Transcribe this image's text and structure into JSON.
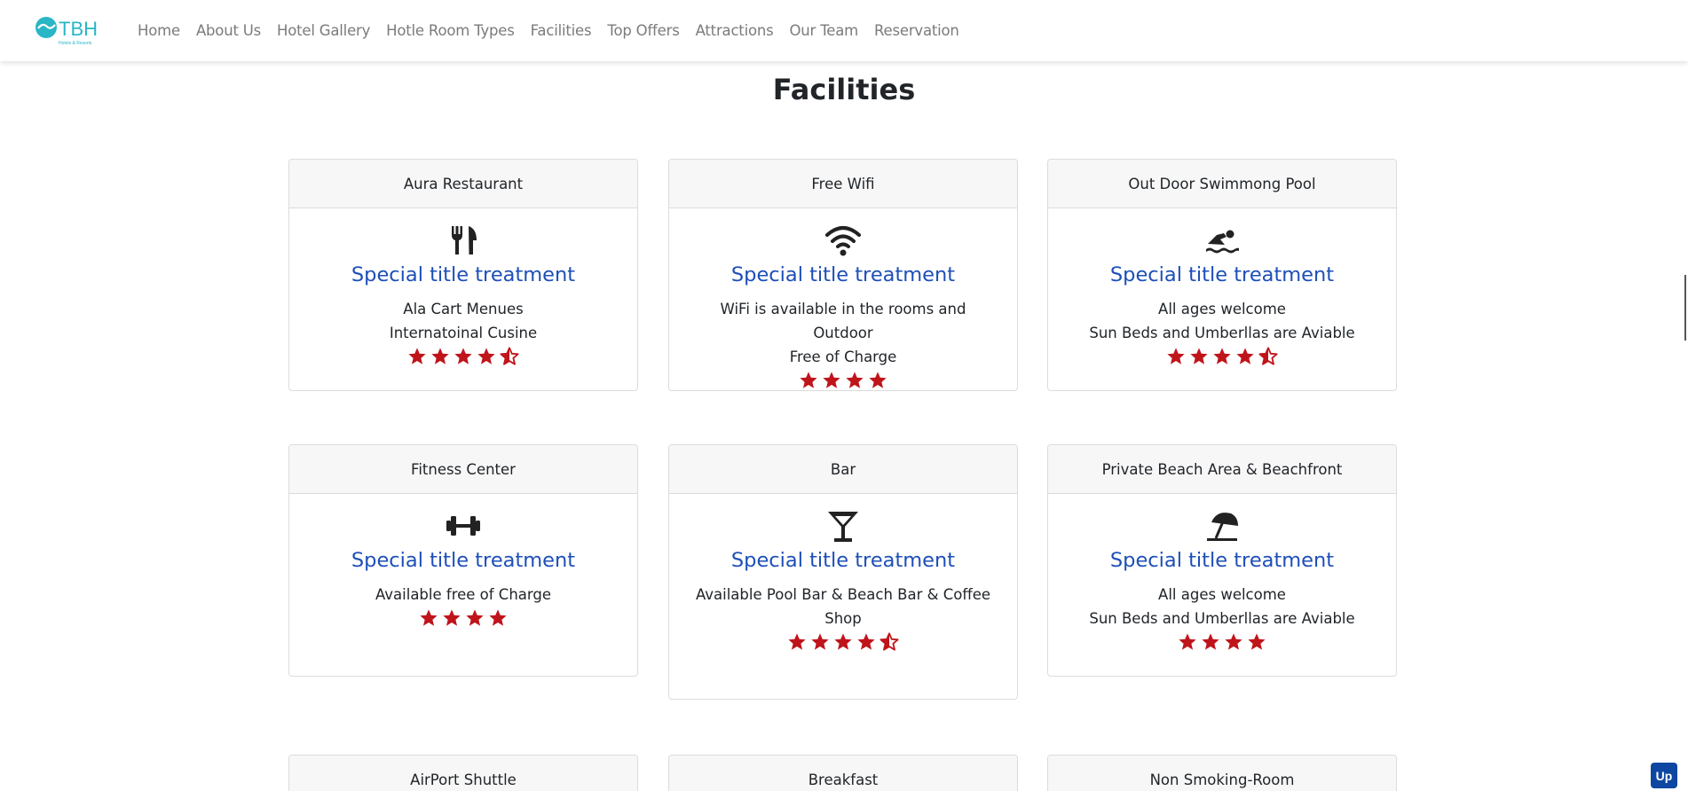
{
  "brand": {
    "logo_text": "TBH",
    "logo_subtext": "Hotels & Resorts",
    "accent_color": "#29b6c6"
  },
  "nav": {
    "items": [
      "Home",
      "About Us",
      "Hotel Gallery",
      "Hotle Room Types",
      "Facilities",
      "Top Offers",
      "Attractions",
      "Our Team",
      "Reservation"
    ]
  },
  "section": {
    "title": "Facilities"
  },
  "colors": {
    "title_blue": "#1d4fb8",
    "star_red": "#c0141b"
  },
  "cards": [
    {
      "header": "Aura Restaurant",
      "icon": "utensils-icon",
      "title": "Special title treatment",
      "lines": [
        "Ala Cart Menues",
        "Internatoinal Cusine"
      ],
      "rating": 4.5
    },
    {
      "header": "Free Wifi",
      "icon": "wifi-icon",
      "title": "Special title treatment",
      "lines": [
        "WiFi is available in the rooms and Outdoor",
        "Free of Charge"
      ],
      "rating": 4
    },
    {
      "header": "Out Door Swimmong Pool",
      "icon": "swimmer-icon",
      "title": "Special title treatment",
      "lines": [
        "All ages welcome",
        "Sun Beds and Umberllas are Aviable"
      ],
      "rating": 4.5
    },
    {
      "header": "Fitness Center",
      "icon": "dumbbell-icon",
      "title": "Special title treatment",
      "lines": [
        "Available free of Charge"
      ],
      "rating": 4
    },
    {
      "header": "Bar",
      "icon": "cocktail-icon",
      "title": "Special title treatment",
      "lines": [
        "Available Pool Bar & Beach Bar & Coffee",
        "Shop"
      ],
      "rating": 4.5
    },
    {
      "header": "Private Beach Area & Beachfront",
      "icon": "beach-umbrella-icon",
      "title": "Special title treatment",
      "lines": [
        "All ages welcome",
        "Sun Beds and Umberllas are Aviable"
      ],
      "rating": 4
    },
    {
      "header": "AirPort Shuttle"
    },
    {
      "header": "Breakfast"
    },
    {
      "header": "Non Smoking-Room"
    }
  ],
  "up_button": {
    "label": "Up"
  }
}
